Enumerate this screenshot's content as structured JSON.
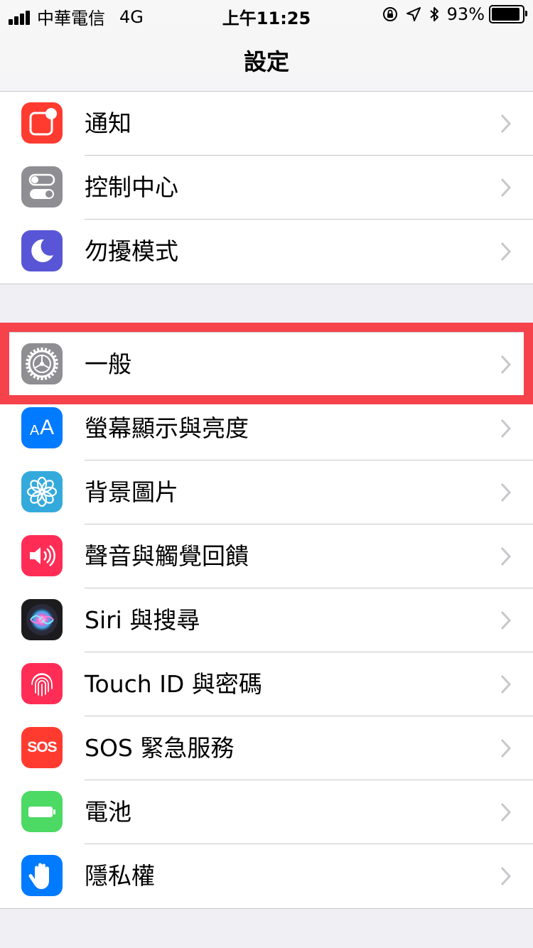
{
  "status_bar": {
    "carrier": "中華電信",
    "network": "4G",
    "time": "上午11:25",
    "battery_percent": "93%",
    "battery_level": 0.93
  },
  "nav": {
    "title": "設定"
  },
  "colors": {
    "highlight": "#f5424b",
    "chevron": "#c7c7cc",
    "separator": "#c8c7cc",
    "background": "#efeff4"
  },
  "group1": [
    {
      "label": "通知",
      "icon": "notifications-icon",
      "color": "#ff3b30"
    },
    {
      "label": "控制中心",
      "icon": "control-center-icon",
      "color": "#8e8e93"
    },
    {
      "label": "勿擾模式",
      "icon": "moon-icon",
      "color": "#5856d6"
    }
  ],
  "group2": [
    {
      "label": "一般",
      "icon": "gear-icon",
      "color": "#8e8e93"
    },
    {
      "label": "螢幕顯示與亮度",
      "icon": "text-size-icon",
      "color": "#007aff"
    },
    {
      "label": "背景圖片",
      "icon": "wallpaper-flower-icon",
      "color": "#34aadc"
    },
    {
      "label": "聲音與觸覺回饋",
      "icon": "speaker-icon",
      "color": "#ff2d55"
    },
    {
      "label": "Siri 與搜尋",
      "icon": "siri-icon",
      "color": "#1c1c1e"
    },
    {
      "label": "Touch ID 與密碼",
      "icon": "fingerprint-icon",
      "color": "#ff2d55"
    },
    {
      "label": "SOS 緊急服務",
      "icon": "sos-icon",
      "color": "#ff3b30",
      "icon_text": "SOS"
    },
    {
      "label": "電池",
      "icon": "battery-icon",
      "color": "#4cd964"
    },
    {
      "label": "隱私權",
      "icon": "hand-icon",
      "color": "#007aff"
    }
  ],
  "icon_text": {
    "aa_small": "A",
    "aa_large": "A"
  }
}
